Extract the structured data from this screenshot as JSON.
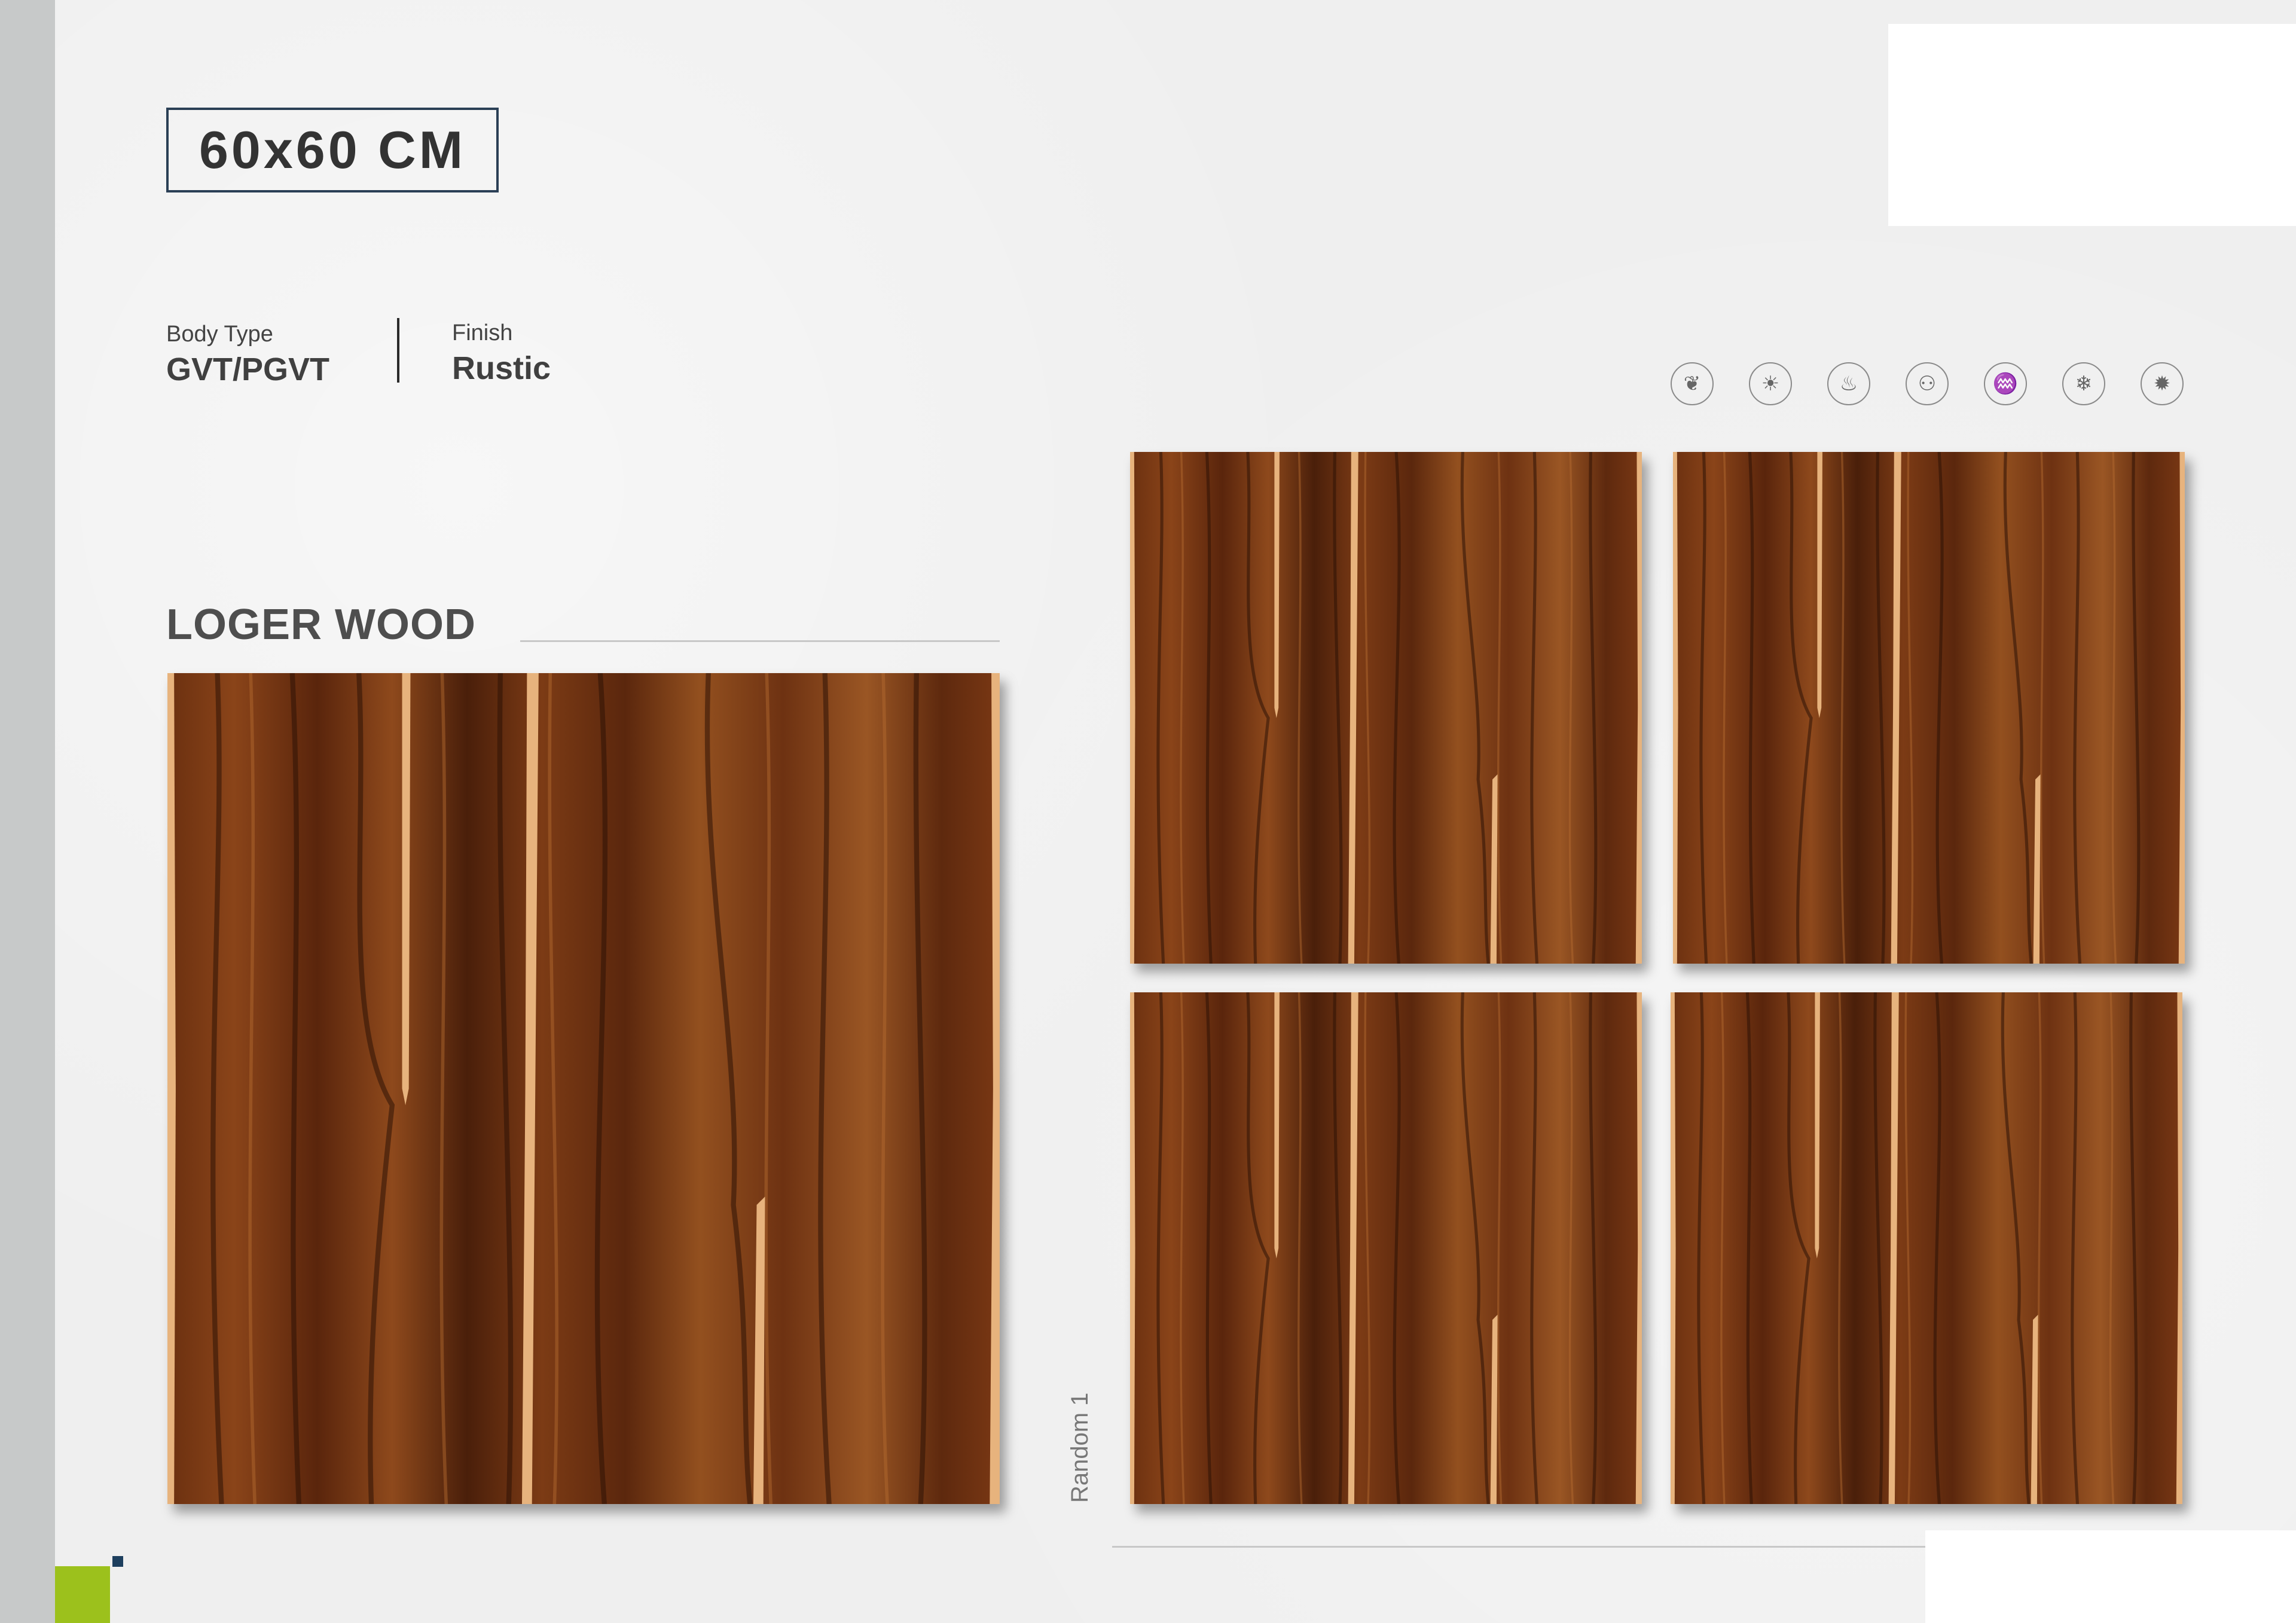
{
  "header": {
    "size": "60x60 CM"
  },
  "specs": [
    {
      "label": "Body Type",
      "value": "GVT/PGVT"
    },
    {
      "label": "Finish",
      "value": "Rustic"
    }
  ],
  "feature_icons": [
    {
      "name": "leaf-icon",
      "glyph": "❦"
    },
    {
      "name": "sun-icon",
      "glyph": "☀"
    },
    {
      "name": "fire-icon",
      "glyph": "♨"
    },
    {
      "name": "people-icon",
      "glyph": "⚇"
    },
    {
      "name": "bathtub-icon",
      "glyph": "♒"
    },
    {
      "name": "snowflake-icon",
      "glyph": "❄"
    },
    {
      "name": "gear-icon",
      "glyph": "✹"
    }
  ],
  "product": {
    "name": "LOGER WOOD"
  },
  "variant_label": "Random 1",
  "colors": {
    "accent_green": "#9cc11c",
    "accent_navy": "#1d3f5e",
    "wood_dark": "#3d1a08",
    "wood_mid": "#7a3a14",
    "wood_light": "#a8612a",
    "wood_stripe": "#e7b37d"
  }
}
